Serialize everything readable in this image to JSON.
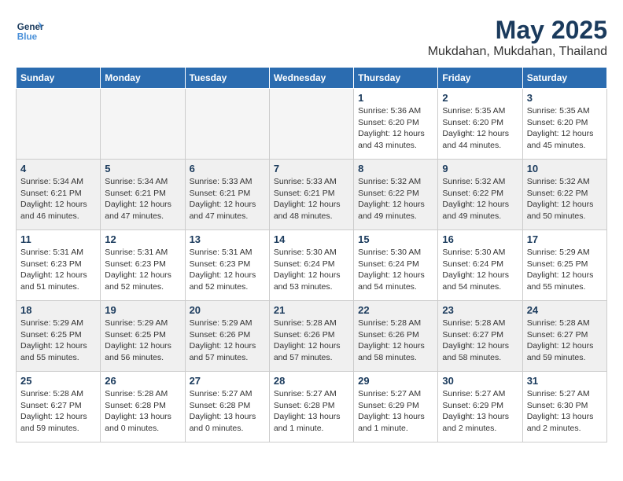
{
  "header": {
    "logo": "GeneralBlue",
    "month_year": "May 2025",
    "location": "Mukdahan, Mukdahan, Thailand"
  },
  "days_of_week": [
    "Sunday",
    "Monday",
    "Tuesday",
    "Wednesday",
    "Thursday",
    "Friday",
    "Saturday"
  ],
  "weeks": [
    [
      {
        "day": "",
        "empty": true
      },
      {
        "day": "",
        "empty": true
      },
      {
        "day": "",
        "empty": true
      },
      {
        "day": "",
        "empty": true
      },
      {
        "day": "1",
        "lines": [
          "Sunrise: 5:36 AM",
          "Sunset: 6:20 PM",
          "Daylight: 12 hours",
          "and 43 minutes."
        ]
      },
      {
        "day": "2",
        "lines": [
          "Sunrise: 5:35 AM",
          "Sunset: 6:20 PM",
          "Daylight: 12 hours",
          "and 44 minutes."
        ]
      },
      {
        "day": "3",
        "lines": [
          "Sunrise: 5:35 AM",
          "Sunset: 6:20 PM",
          "Daylight: 12 hours",
          "and 45 minutes."
        ]
      }
    ],
    [
      {
        "day": "4",
        "lines": [
          "Sunrise: 5:34 AM",
          "Sunset: 6:21 PM",
          "Daylight: 12 hours",
          "and 46 minutes."
        ]
      },
      {
        "day": "5",
        "lines": [
          "Sunrise: 5:34 AM",
          "Sunset: 6:21 PM",
          "Daylight: 12 hours",
          "and 47 minutes."
        ]
      },
      {
        "day": "6",
        "lines": [
          "Sunrise: 5:33 AM",
          "Sunset: 6:21 PM",
          "Daylight: 12 hours",
          "and 47 minutes."
        ]
      },
      {
        "day": "7",
        "lines": [
          "Sunrise: 5:33 AM",
          "Sunset: 6:21 PM",
          "Daylight: 12 hours",
          "and 48 minutes."
        ]
      },
      {
        "day": "8",
        "lines": [
          "Sunrise: 5:32 AM",
          "Sunset: 6:22 PM",
          "Daylight: 12 hours",
          "and 49 minutes."
        ]
      },
      {
        "day": "9",
        "lines": [
          "Sunrise: 5:32 AM",
          "Sunset: 6:22 PM",
          "Daylight: 12 hours",
          "and 49 minutes."
        ]
      },
      {
        "day": "10",
        "lines": [
          "Sunrise: 5:32 AM",
          "Sunset: 6:22 PM",
          "Daylight: 12 hours",
          "and 50 minutes."
        ]
      }
    ],
    [
      {
        "day": "11",
        "lines": [
          "Sunrise: 5:31 AM",
          "Sunset: 6:23 PM",
          "Daylight: 12 hours",
          "and 51 minutes."
        ]
      },
      {
        "day": "12",
        "lines": [
          "Sunrise: 5:31 AM",
          "Sunset: 6:23 PM",
          "Daylight: 12 hours",
          "and 52 minutes."
        ]
      },
      {
        "day": "13",
        "lines": [
          "Sunrise: 5:31 AM",
          "Sunset: 6:23 PM",
          "Daylight: 12 hours",
          "and 52 minutes."
        ]
      },
      {
        "day": "14",
        "lines": [
          "Sunrise: 5:30 AM",
          "Sunset: 6:24 PM",
          "Daylight: 12 hours",
          "and 53 minutes."
        ]
      },
      {
        "day": "15",
        "lines": [
          "Sunrise: 5:30 AM",
          "Sunset: 6:24 PM",
          "Daylight: 12 hours",
          "and 54 minutes."
        ]
      },
      {
        "day": "16",
        "lines": [
          "Sunrise: 5:30 AM",
          "Sunset: 6:24 PM",
          "Daylight: 12 hours",
          "and 54 minutes."
        ]
      },
      {
        "day": "17",
        "lines": [
          "Sunrise: 5:29 AM",
          "Sunset: 6:25 PM",
          "Daylight: 12 hours",
          "and 55 minutes."
        ]
      }
    ],
    [
      {
        "day": "18",
        "lines": [
          "Sunrise: 5:29 AM",
          "Sunset: 6:25 PM",
          "Daylight: 12 hours",
          "and 55 minutes."
        ]
      },
      {
        "day": "19",
        "lines": [
          "Sunrise: 5:29 AM",
          "Sunset: 6:25 PM",
          "Daylight: 12 hours",
          "and 56 minutes."
        ]
      },
      {
        "day": "20",
        "lines": [
          "Sunrise: 5:29 AM",
          "Sunset: 6:26 PM",
          "Daylight: 12 hours",
          "and 57 minutes."
        ]
      },
      {
        "day": "21",
        "lines": [
          "Sunrise: 5:28 AM",
          "Sunset: 6:26 PM",
          "Daylight: 12 hours",
          "and 57 minutes."
        ]
      },
      {
        "day": "22",
        "lines": [
          "Sunrise: 5:28 AM",
          "Sunset: 6:26 PM",
          "Daylight: 12 hours",
          "and 58 minutes."
        ]
      },
      {
        "day": "23",
        "lines": [
          "Sunrise: 5:28 AM",
          "Sunset: 6:27 PM",
          "Daylight: 12 hours",
          "and 58 minutes."
        ]
      },
      {
        "day": "24",
        "lines": [
          "Sunrise: 5:28 AM",
          "Sunset: 6:27 PM",
          "Daylight: 12 hours",
          "and 59 minutes."
        ]
      }
    ],
    [
      {
        "day": "25",
        "lines": [
          "Sunrise: 5:28 AM",
          "Sunset: 6:27 PM",
          "Daylight: 12 hours",
          "and 59 minutes."
        ]
      },
      {
        "day": "26",
        "lines": [
          "Sunrise: 5:28 AM",
          "Sunset: 6:28 PM",
          "Daylight: 13 hours",
          "and 0 minutes."
        ]
      },
      {
        "day": "27",
        "lines": [
          "Sunrise: 5:27 AM",
          "Sunset: 6:28 PM",
          "Daylight: 13 hours",
          "and 0 minutes."
        ]
      },
      {
        "day": "28",
        "lines": [
          "Sunrise: 5:27 AM",
          "Sunset: 6:28 PM",
          "Daylight: 13 hours",
          "and 1 minute."
        ]
      },
      {
        "day": "29",
        "lines": [
          "Sunrise: 5:27 AM",
          "Sunset: 6:29 PM",
          "Daylight: 13 hours",
          "and 1 minute."
        ]
      },
      {
        "day": "30",
        "lines": [
          "Sunrise: 5:27 AM",
          "Sunset: 6:29 PM",
          "Daylight: 13 hours",
          "and 2 minutes."
        ]
      },
      {
        "day": "31",
        "lines": [
          "Sunrise: 5:27 AM",
          "Sunset: 6:30 PM",
          "Daylight: 13 hours",
          "and 2 minutes."
        ]
      }
    ]
  ]
}
